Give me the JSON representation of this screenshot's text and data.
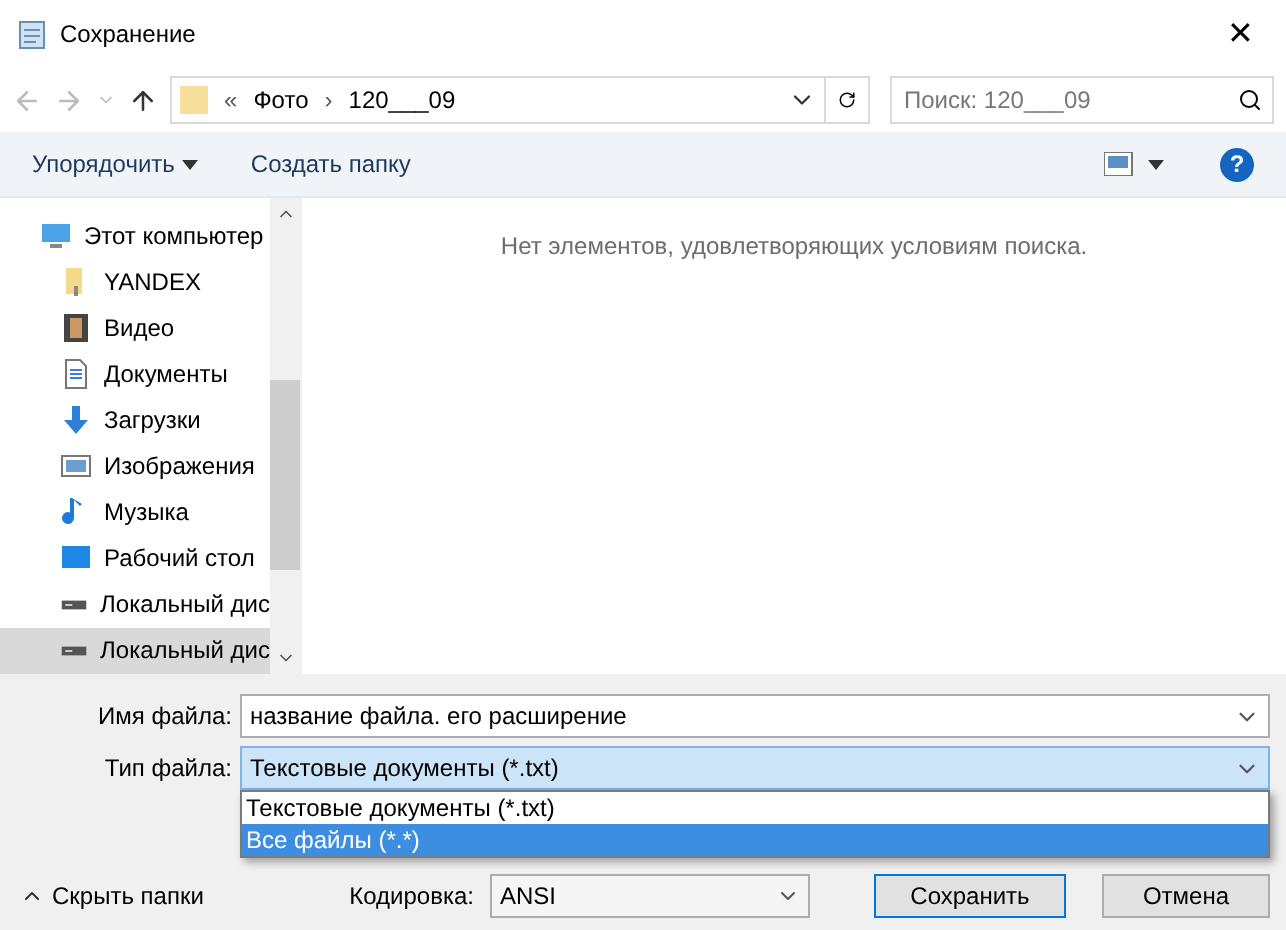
{
  "window": {
    "title": "Сохранение",
    "close": "✕"
  },
  "address": {
    "prefix": "«",
    "crumbs": [
      "Фото",
      "120___09"
    ],
    "separator": "›"
  },
  "search": {
    "placeholder": "Поиск: 120___09"
  },
  "toolbar": {
    "organize": "Упорядочить",
    "new_folder": "Создать папку",
    "help": "?"
  },
  "sidebar": {
    "items": [
      {
        "label": "Этот компьютер",
        "kind": "computer",
        "selected": false,
        "children": [
          {
            "label": "YANDEX",
            "kind": "folder",
            "selected": false
          },
          {
            "label": "Видео",
            "kind": "video",
            "selected": false
          },
          {
            "label": "Документы",
            "kind": "document",
            "selected": false
          },
          {
            "label": "Загрузки",
            "kind": "download",
            "selected": false
          },
          {
            "label": "Изображения",
            "kind": "image",
            "selected": false
          },
          {
            "label": "Музыка",
            "kind": "music",
            "selected": false
          },
          {
            "label": "Рабочий стол",
            "kind": "desktop",
            "selected": false
          },
          {
            "label": "Локальный дис",
            "kind": "drive",
            "selected": false
          },
          {
            "label": "Локальный дис",
            "kind": "drive",
            "selected": true
          }
        ]
      }
    ]
  },
  "content": {
    "empty_message": "Нет элементов, удовлетворяющих условиям поиска."
  },
  "form": {
    "file_name_label": "Имя файла:",
    "file_name": "название файла. его расширение",
    "file_type_label": "Тип файла:",
    "file_type": "Текстовые документы (*.txt)",
    "file_type_options": [
      {
        "label": "Текстовые документы (*.txt)",
        "selected": false
      },
      {
        "label": "Все файлы  (*.*)",
        "selected": true
      }
    ],
    "encoding_label": "Кодировка:",
    "encoding": "ANSI",
    "save": "Сохранить",
    "cancel": "Отмена",
    "hide_folders": "Скрыть папки"
  }
}
